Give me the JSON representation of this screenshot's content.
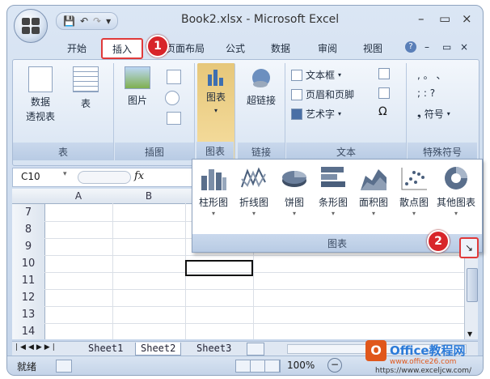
{
  "window": {
    "title": "Book2.xlsx - Microsoft Excel",
    "controls": {
      "minimize": "–",
      "maximize": "▭",
      "close": "×"
    }
  },
  "quick_access": {
    "save": "💾",
    "undo": "↶",
    "redo": "↷",
    "customize": "▾"
  },
  "ribbon_tabs": {
    "home": "开始",
    "insert": "插入",
    "page_layout": "页面布局",
    "formulas": "公式",
    "data": "数据",
    "review": "审阅",
    "view": "视图",
    "help": "?",
    "min": "–",
    "restore": "▭",
    "close": "×"
  },
  "ribbon": {
    "tables": {
      "label": "表",
      "pivot": "数据\n透视表",
      "table": "表"
    },
    "illustrations": {
      "label": "插图",
      "picture": "图片"
    },
    "charts": {
      "label": "图表",
      "chart": "图表"
    },
    "links": {
      "label": "链接",
      "hyperlink": "超链接"
    },
    "text": {
      "label": "文本",
      "textbox": "文本框",
      "header_footer": "页眉和页脚",
      "wordart": "艺术字"
    },
    "symbols": {
      "label": "特殊符号",
      "symbol": "符号",
      "row1": ",  。 、",
      "row2": ";  :  ?",
      "omega": "Ω"
    }
  },
  "formula_bar": {
    "name_box": "C10",
    "fx": "fx"
  },
  "grid": {
    "columns": [
      "A",
      "B"
    ],
    "rows": [
      "7",
      "8",
      "9",
      "10",
      "11",
      "12",
      "13",
      "14"
    ],
    "selected_cell": "C10"
  },
  "chart_menu": {
    "group_label": "图表",
    "types": [
      {
        "label": "柱形图",
        "icon": "column-chart-icon"
      },
      {
        "label": "折线图",
        "icon": "line-chart-icon"
      },
      {
        "label": "饼图",
        "icon": "pie-chart-icon"
      },
      {
        "label": "条形图",
        "icon": "bar-chart-icon"
      },
      {
        "label": "面积图",
        "icon": "area-chart-icon"
      },
      {
        "label": "散点图",
        "icon": "scatter-chart-icon"
      },
      {
        "label": "其他图表",
        "icon": "doughnut-chart-icon"
      }
    ]
  },
  "annotations": {
    "step1": "1",
    "step2": "2"
  },
  "sheets": {
    "tabs": [
      "Sheet1",
      "Sheet2",
      "Sheet3"
    ],
    "active": "Sheet2"
  },
  "status": {
    "ready": "就绪",
    "zoom": "100%"
  },
  "watermark": {
    "brand": "Office教程网",
    "url": "https://www.exceljcw.com/",
    "sub": "www.office26.com"
  },
  "colors": {
    "accent_red": "#d8252a",
    "ribbon": "#dbe6f4"
  }
}
